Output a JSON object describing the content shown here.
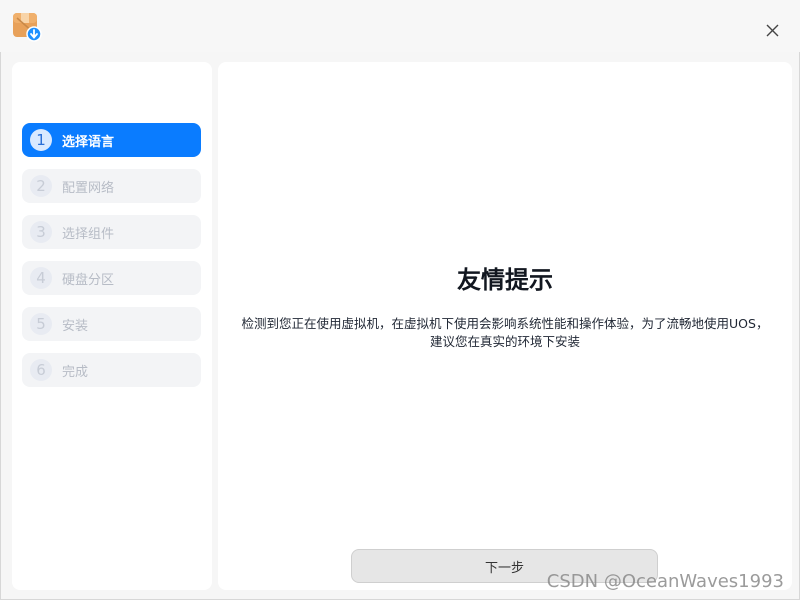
{
  "sidebar": {
    "steps": [
      {
        "number": "1",
        "label": "选择语言",
        "active": true
      },
      {
        "number": "2",
        "label": "配置网络"
      },
      {
        "number": "3",
        "label": "选择组件"
      },
      {
        "number": "4",
        "label": "硬盘分区"
      },
      {
        "number": "5",
        "label": "安装"
      },
      {
        "number": "6",
        "label": "完成"
      }
    ]
  },
  "main": {
    "title": "友情提示",
    "message": "检测到您正在使用虚拟机，在虚拟机下使用会影响系统性能和操作体验，为了流畅地使用UOS，建议您在真实的环境下安装",
    "next_button": "下一步"
  },
  "watermark": "CSDN @OceanWaves1993",
  "colors": {
    "accent": "#0a7cff"
  },
  "icons": {
    "app": "package-install-icon",
    "close": "close-icon"
  }
}
